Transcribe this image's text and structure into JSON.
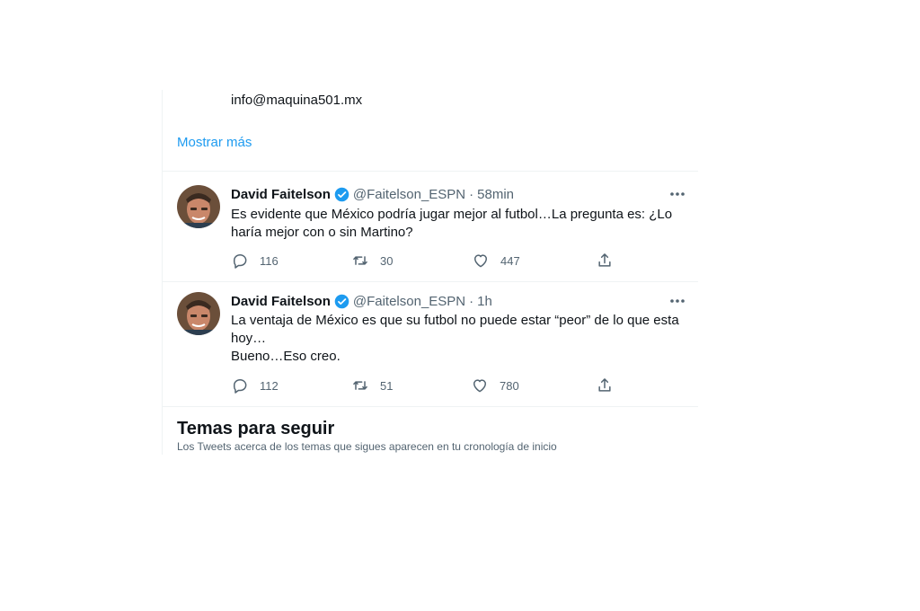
{
  "top": {
    "cut_text": "info@maquina501.mx",
    "show_more": "Mostrar más"
  },
  "tweets": [
    {
      "name": "David Faitelson",
      "handle": "@Faitelson_ESPN",
      "time": "58min",
      "lines": [
        "Es evidente que México podría jugar mejor al futbol…La pregunta es: ¿Lo",
        "haría mejor con o sin Martino?"
      ],
      "replies": "116",
      "retweets": "30",
      "likes": "447"
    },
    {
      "name": "David Faitelson",
      "handle": "@Faitelson_ESPN",
      "time": "1h",
      "lines": [
        "La ventaja de México es que su futbol no puede estar “peor” de lo que esta",
        "hoy…",
        "Bueno…Eso creo."
      ],
      "replies": "112",
      "retweets": "51",
      "likes": "780"
    }
  ],
  "topics": {
    "title": "Temas para seguir",
    "subtitle": "Los Tweets acerca de los temas que sigues aparecen en tu cronología de inicio"
  },
  "colors": {
    "accent": "#1d9bf0",
    "muted": "#536471",
    "text": "#0f1419",
    "border": "#eff3f4"
  },
  "icons": [
    "verified-badge-icon",
    "more-icon",
    "reply-icon",
    "retweet-icon",
    "like-icon",
    "share-icon"
  ]
}
